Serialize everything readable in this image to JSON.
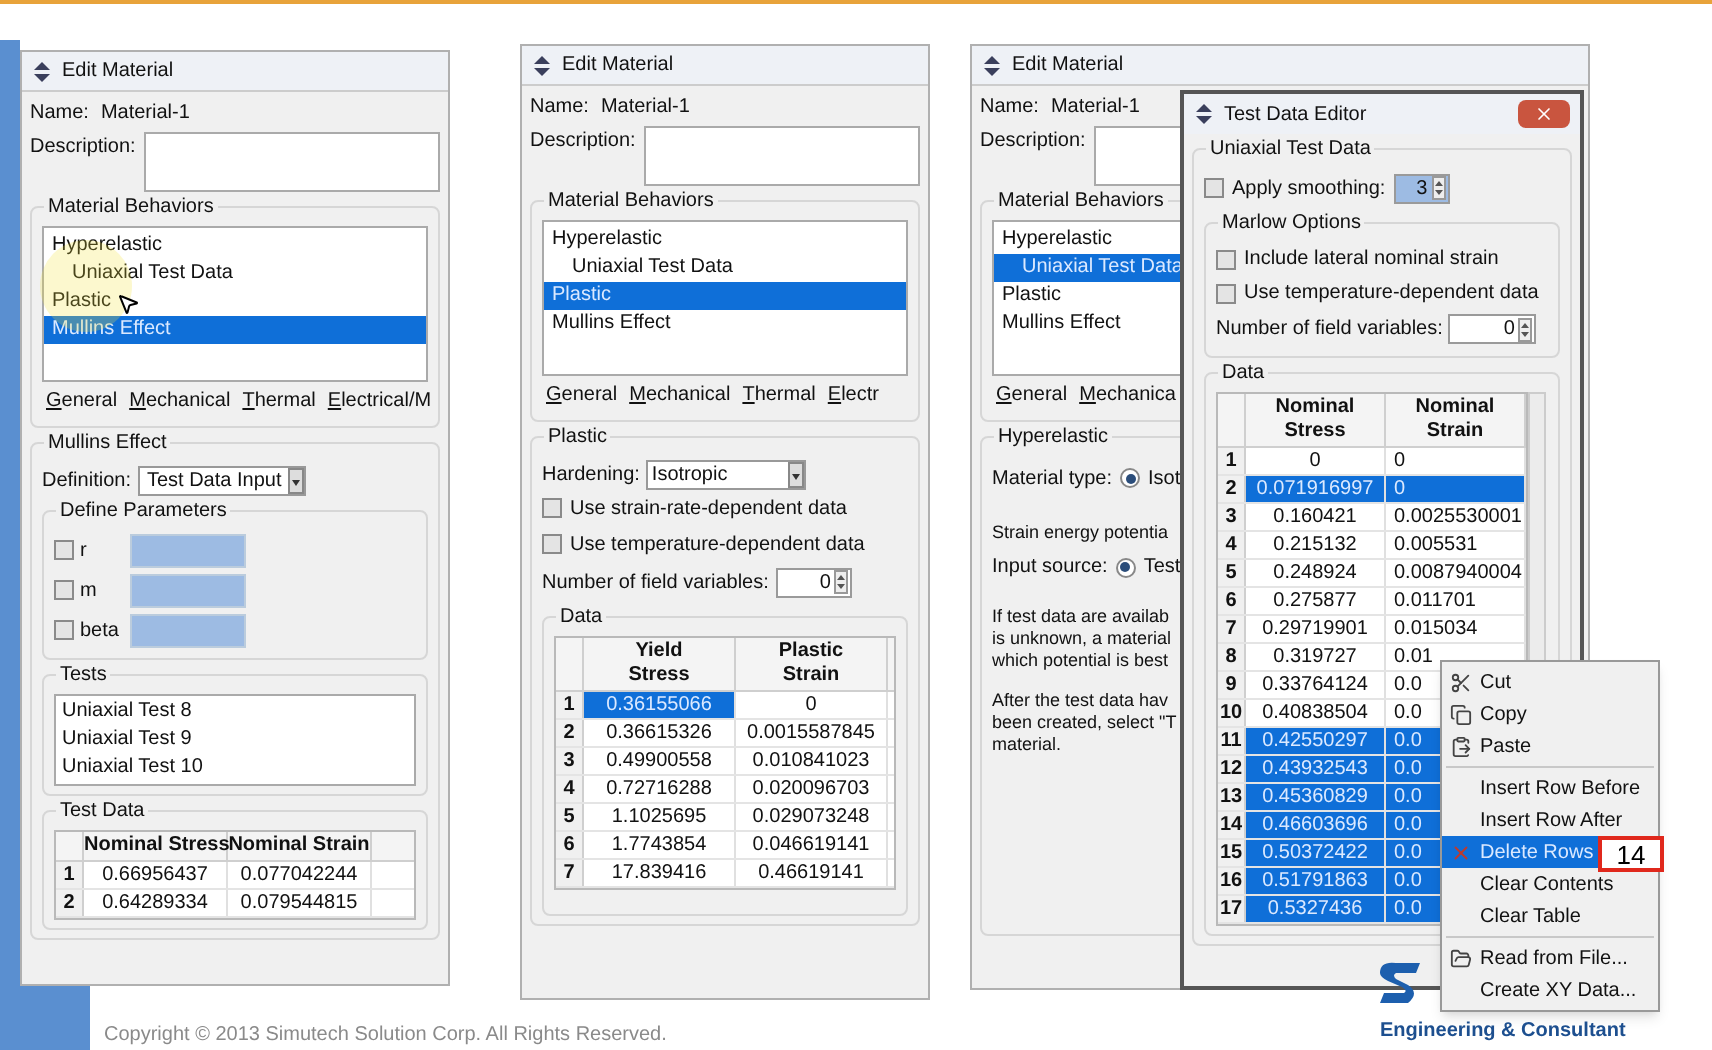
{
  "panels": [
    {
      "title": "Edit Material",
      "name_label": "Name:",
      "name": "Material-1",
      "description_label": "Description:",
      "behaviors_title": "Material Behaviors",
      "behaviors": [
        {
          "label": "Hyperelastic",
          "selected": false,
          "children": [
            {
              "label": "Uniaxial Test Data",
              "selected": false
            }
          ]
        },
        {
          "label": "Plastic",
          "selected": false
        },
        {
          "label": "Mullins Effect",
          "selected": true
        }
      ],
      "menus": [
        "General",
        "Mechanical",
        "Thermal",
        "Electrical/M"
      ],
      "section": {
        "kind": "mullins",
        "title": "Mullins Effect",
        "definition_label": "Definition:",
        "definition": "Test Data Input",
        "parameters_title": "Define Parameters",
        "parameters": [
          {
            "label": "r",
            "checked": false
          },
          {
            "label": "m",
            "checked": false
          },
          {
            "label": "beta",
            "checked": false
          }
        ],
        "tests_title": "Tests",
        "tests": [
          "Uniaxial Test 8",
          "Uniaxial Test 9",
          "Uniaxial Test 10"
        ],
        "table_title": "Test Data",
        "table": {
          "columns": [
            "Nominal Stress",
            "Nominal Strain"
          ],
          "rows": [
            {
              "index": "1",
              "cells": [
                {
                  "text": "0.66956437",
                  "selected": false
                },
                {
                  "text": "0.077042244",
                  "selected": false
                }
              ]
            },
            {
              "index": "2",
              "cells": [
                {
                  "text": "0.64289334",
                  "selected": false
                },
                {
                  "text": "0.079544815",
                  "selected": false
                }
              ]
            }
          ]
        }
      }
    },
    {
      "title": "Edit Material",
      "name_label": "Name:",
      "name": "Material-1",
      "description_label": "Description:",
      "behaviors_title": "Material Behaviors",
      "behaviors": [
        {
          "label": "Hyperelastic",
          "selected": false,
          "children": [
            {
              "label": "Uniaxial Test Data",
              "selected": false
            }
          ]
        },
        {
          "label": "Plastic",
          "selected": true
        },
        {
          "label": "Mullins Effect",
          "selected": false
        }
      ],
      "menus": [
        "General",
        "Mechanical",
        "Thermal",
        "Electr"
      ],
      "section": {
        "kind": "plastic",
        "title": "Plastic",
        "hardening_label": "Hardening:",
        "hardening": "Isotropic",
        "options": [
          {
            "label": "Use strain-rate-dependent data",
            "checked": false
          },
          {
            "label": "Use temperature-dependent data",
            "checked": false
          }
        ],
        "field_vars_label": "Number of field variables:",
        "field_vars": "0",
        "table_title": "Data",
        "table": {
          "columns": [
            "Yield Stress",
            "Plastic Strain"
          ],
          "rows": [
            {
              "index": "1",
              "cells": [
                {
                  "text": "0.36155066",
                  "selected": true
                },
                {
                  "text": "0",
                  "selected": false
                }
              ]
            },
            {
              "index": "2",
              "cells": [
                {
                  "text": "0.36615326",
                  "selected": false
                },
                {
                  "text": "0.0015587845",
                  "selected": false
                }
              ]
            },
            {
              "index": "3",
              "cells": [
                {
                  "text": "0.49900558",
                  "selected": false
                },
                {
                  "text": "0.010841023",
                  "selected": false
                }
              ]
            },
            {
              "index": "4",
              "cells": [
                {
                  "text": "0.72716288",
                  "selected": false
                },
                {
                  "text": "0.020096703",
                  "selected": false
                }
              ]
            },
            {
              "index": "5",
              "cells": [
                {
                  "text": "1.1025695",
                  "selected": false
                },
                {
                  "text": "0.029073248",
                  "selected": false
                }
              ]
            },
            {
              "index": "6",
              "cells": [
                {
                  "text": "1.7743854",
                  "selected": false
                },
                {
                  "text": "0.046619141",
                  "selected": false
                }
              ]
            },
            {
              "index": "7",
              "cells": [
                {
                  "text": "17.839416",
                  "selected": false
                },
                {
                  "text": "0.46619141",
                  "selected": false
                }
              ]
            }
          ]
        }
      }
    },
    {
      "title": "Edit Material",
      "name_label": "Name:",
      "name": "Material-1",
      "description_label": "Description:",
      "behaviors_title": "Material Behaviors",
      "behaviors": [
        {
          "label": "Hyperelastic",
          "selected": false,
          "children": [
            {
              "label": "Uniaxial Test Data",
              "selected": true
            }
          ]
        },
        {
          "label": "Plastic",
          "selected": false
        },
        {
          "label": "Mullins Effect",
          "selected": false
        }
      ],
      "menus": [
        "General",
        "Mechanica"
      ],
      "section": {
        "kind": "hyperelastic",
        "title": "Hyperelastic",
        "material_type_label": "Material type:",
        "material_type": {
          "label": "Isot",
          "selected": true
        },
        "strain_energy": "Strain energy potentia",
        "input_source_label": "Input source:",
        "input_source": {
          "label": "Test",
          "selected": true
        },
        "paragraphs": [
          [
            "If test data are availab",
            "is unknown, a material",
            "which potential is best"
          ],
          [
            "After the test data hav",
            "been created, select \"T",
            "material."
          ]
        ]
      }
    }
  ],
  "editor": {
    "title": "Test Data Editor",
    "group_title": "Uniaxial Test Data",
    "smoothing": {
      "label": "Apply smoothing:",
      "checked": false,
      "value": "3"
    },
    "marlow_title": "Marlow Options",
    "options": [
      {
        "label": "Include lateral nominal strain",
        "checked": false
      },
      {
        "label": "Use temperature-dependent data",
        "checked": false
      }
    ],
    "field_vars_label": "Number of field variables:",
    "field_vars": "0",
    "table_title": "Data",
    "table": {
      "columns": [
        "Nominal Stress",
        "Nominal Strain"
      ],
      "rows": [
        {
          "index": "1",
          "cells": [
            {
              "text": "0",
              "selected": false
            },
            {
              "text": "0",
              "selected": false
            }
          ]
        },
        {
          "index": "2",
          "cells": [
            {
              "text": "0.071916997",
              "selected": true
            },
            {
              "text": "0",
              "selected": true
            }
          ]
        },
        {
          "index": "3",
          "cells": [
            {
              "text": "0.160421",
              "selected": false
            },
            {
              "text": "0.0025530001",
              "selected": false
            }
          ]
        },
        {
          "index": "4",
          "cells": [
            {
              "text": "0.215132",
              "selected": false
            },
            {
              "text": "0.005531",
              "selected": false
            }
          ]
        },
        {
          "index": "5",
          "cells": [
            {
              "text": "0.248924",
              "selected": false
            },
            {
              "text": "0.0087940004",
              "selected": false
            }
          ]
        },
        {
          "index": "6",
          "cells": [
            {
              "text": "0.275877",
              "selected": false
            },
            {
              "text": "0.011701",
              "selected": false
            }
          ]
        },
        {
          "index": "7",
          "cells": [
            {
              "text": "0.29719901",
              "selected": false
            },
            {
              "text": "0.015034",
              "selected": false
            }
          ]
        },
        {
          "index": "8",
          "cells": [
            {
              "text": "0.319727",
              "selected": false
            },
            {
              "text": "0.01",
              "selected": false
            }
          ]
        },
        {
          "index": "9",
          "cells": [
            {
              "text": "0.33764124",
              "selected": false
            },
            {
              "text": "0.0",
              "selected": false
            }
          ]
        },
        {
          "index": "10",
          "cells": [
            {
              "text": "0.40838504",
              "selected": false
            },
            {
              "text": "0.0",
              "selected": false
            }
          ]
        },
        {
          "index": "11",
          "cells": [
            {
              "text": "0.42550297",
              "selected": true
            },
            {
              "text": "0.0",
              "selected": true
            }
          ]
        },
        {
          "index": "12",
          "cells": [
            {
              "text": "0.43932543",
              "selected": true
            },
            {
              "text": "0.0",
              "selected": true
            }
          ]
        },
        {
          "index": "13",
          "cells": [
            {
              "text": "0.45360829",
              "selected": true
            },
            {
              "text": "0.0",
              "selected": true
            }
          ]
        },
        {
          "index": "14",
          "cells": [
            {
              "text": "0.46603696",
              "selected": true
            },
            {
              "text": "0.0",
              "selected": true
            }
          ]
        },
        {
          "index": "15",
          "cells": [
            {
              "text": "0.50372422",
              "selected": true
            },
            {
              "text": "0.0",
              "selected": true
            }
          ]
        },
        {
          "index": "16",
          "cells": [
            {
              "text": "0.51791863",
              "selected": true
            },
            {
              "text": "0.0",
              "selected": true
            }
          ]
        },
        {
          "index": "17",
          "cells": [
            {
              "text": "0.5327436",
              "selected": true
            },
            {
              "text": "0.0",
              "selected": true
            }
          ]
        }
      ]
    }
  },
  "context_menu": [
    {
      "kind": "item",
      "label": "Cut",
      "selected": false
    },
    {
      "kind": "item",
      "label": "Copy",
      "selected": false
    },
    {
      "kind": "item",
      "label": "Paste",
      "selected": false
    },
    {
      "kind": "separator"
    },
    {
      "kind": "item",
      "label": "Insert Row Before",
      "selected": false
    },
    {
      "kind": "item",
      "label": "Insert Row After",
      "selected": false
    },
    {
      "kind": "item",
      "label": "Delete Rows",
      "selected": true
    },
    {
      "kind": "item",
      "label": "Clear Contents",
      "selected": false
    },
    {
      "kind": "item",
      "label": "Clear Table",
      "selected": false
    },
    {
      "kind": "separator"
    },
    {
      "kind": "item",
      "label": "Read from File...",
      "selected": false
    },
    {
      "kind": "item",
      "label": "Create XY Data...",
      "selected": false
    }
  ],
  "annotation": "14",
  "footer": {
    "copyright": "Copyright © 2013 Simutech Solution Corp. All Rights Reserved.",
    "tagline": "Engineering & Consultant"
  }
}
